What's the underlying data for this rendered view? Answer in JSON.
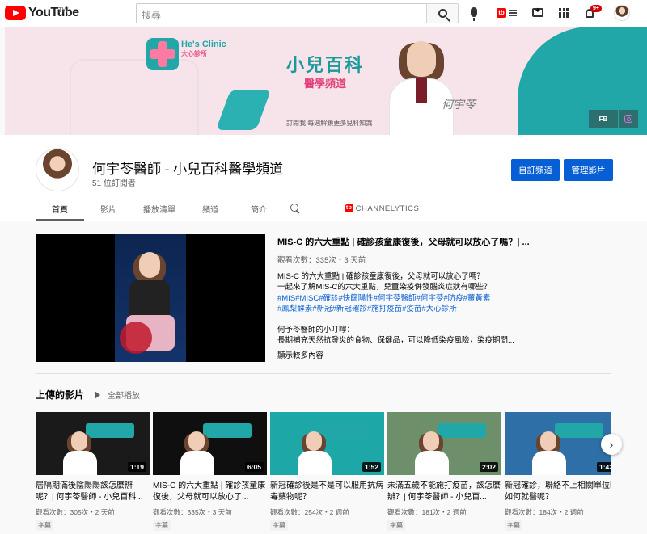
{
  "topbar": {
    "logo_text": "YouTube",
    "region": "TW",
    "search_placeholder": "搜尋",
    "notification_count": "9+"
  },
  "banner": {
    "clinic_name_en": "He's Clinic",
    "clinic_name_zh": "大心診所",
    "title": "小兒百科",
    "subtitle": "醫學頻道",
    "note": "訂閱我 每週解鎖更多兒科知識",
    "signature": "何宇苓",
    "fb_label": "FB"
  },
  "channel": {
    "name": "何宇苓醫師 - 小兒百科醫學頻道",
    "subscribers": "51 位訂閱者",
    "customize_label": "自訂頻道",
    "manage_label": "管理影片"
  },
  "tabs": [
    {
      "label": "首頁"
    },
    {
      "label": "影片"
    },
    {
      "label": "播放清單"
    },
    {
      "label": "頻道"
    },
    {
      "label": "簡介"
    }
  ],
  "channelytics_label": "CHANNELYTICS",
  "featured": {
    "title": "MIS-C 的六大重點 | 確診孩童康復後，父母就可以放心了嗎？| ...",
    "meta": "觀看次數：335次・3 天前",
    "desc_line1": "MIS-C 的六大重點 | 確診孩童康復後，父母就可以放心了嗎？",
    "desc_line2": "一起來了解MIS-C的六大重點，兒童染疫併發腦炎症狀有哪些？",
    "tags_line1": "#MIS#MISC#確診#快篩陽性#何宇苓醫師#何宇苓#防疫#薑黃素",
    "tags_line2": "#鳳梨酵素#新冠#新冠確診#施打疫苗#疫苗#大心診所",
    "desc_line3": "何予苓醫師的小叮嚀：",
    "desc_line4": "長期補充天然抗發炎的食物、保健品，可以降低染疫風險，染疫期間...",
    "more": "顯示較多內容"
  },
  "uploads": {
    "title": "上傳的影片",
    "play_all": "全部播放",
    "videos": [
      {
        "title": "居隔期滿後陰陽陽該怎麼辦呢？| 何宇苓醫師 - 小兒百科...",
        "duration": "1:19",
        "meta": "觀看次數：305次・2 天前",
        "cc": "字幕",
        "bg": "#1a1a1a"
      },
      {
        "title": "MIS-C 的六大重點 | 確診孩童康復後，父母就可以放心了...",
        "duration": "6:05",
        "meta": "觀看次數：335次・3 天前",
        "cc": "字幕",
        "bg": "#0f0f0f"
      },
      {
        "title": "新冠確診後是不是可以服用抗病毒藥物呢？",
        "duration": "1:52",
        "meta": "觀看次數：254次・2 週前",
        "cc": "字幕",
        "bg": "#1ea7a7"
      },
      {
        "title": "未滿五歲不能施打疫苗，該怎麼辦？| 何宇苓醫師 - 小兒百...",
        "duration": "2:02",
        "meta": "觀看次數：181次・2 週前",
        "cc": "字幕",
        "bg": "#6d8f6a"
      },
      {
        "title": "新冠確診，聯絡不上相關單位時如何就醫呢？",
        "duration": "1:42",
        "meta": "觀看次數：184次・2 週前",
        "cc": "字幕",
        "bg": "#2f6fa8"
      }
    ]
  },
  "colors": {
    "accent_blue": "#065fd4",
    "youtube_red": "#ff0000",
    "banner_pink": "#f7e3ea",
    "banner_teal": "#21a7a7"
  }
}
